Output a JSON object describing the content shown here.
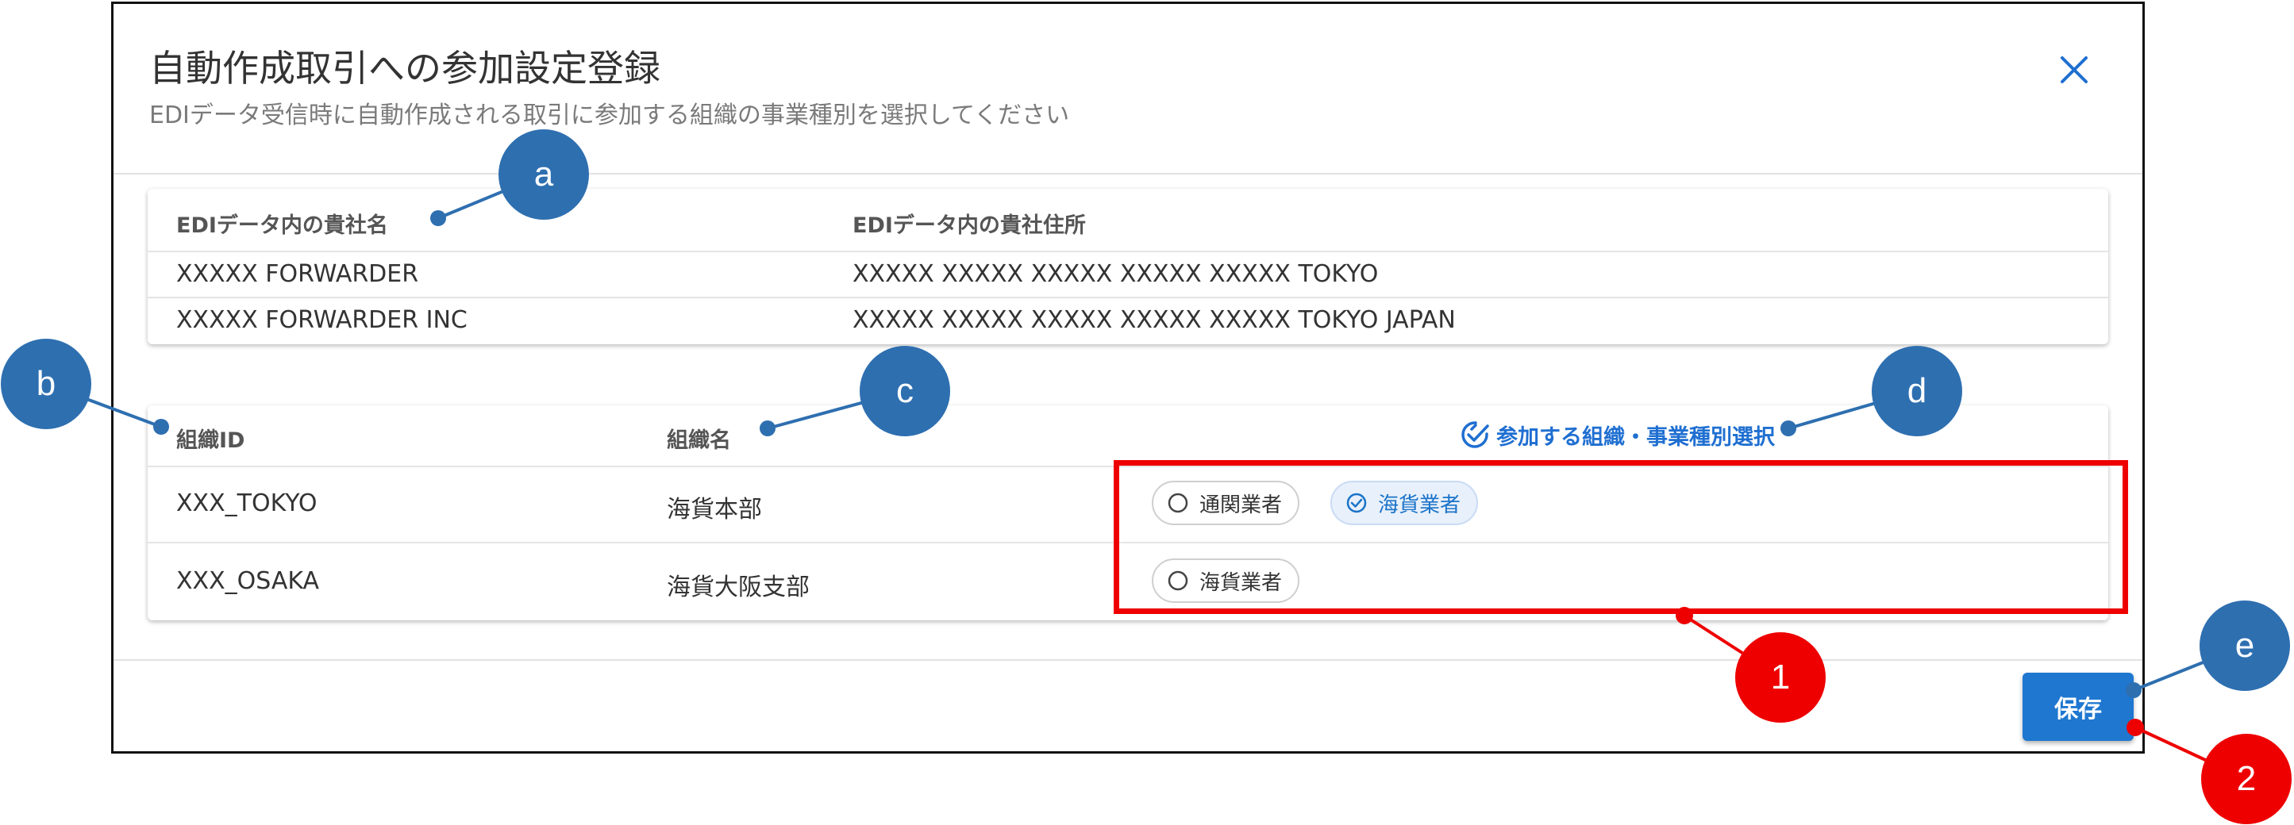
{
  "dialog": {
    "title": "自動作成取引への参加設定登録",
    "subtitle": "EDIデータ受信時に自動作成される取引に参加する組織の事業種別を選択してください",
    "close_glyph": "✕"
  },
  "edi_table": {
    "headers": [
      "EDIデータ内の貴社名",
      "EDIデータ内の貴社住所"
    ],
    "rows": [
      [
        "XXXXX FORWARDER",
        "XXXXX XXXXX XXXXX XXXXX XXXXX TOKYO"
      ],
      [
        "XXXXX FORWARDER INC",
        "XXXXX XXXXX XXXXX XXXXX XXXXX TOKYO JAPAN"
      ]
    ]
  },
  "org_table": {
    "headers": [
      "組織ID",
      "組織名"
    ],
    "select_header": "参加する組織・事業種別選択",
    "rows": [
      {
        "id": "XXX_TOKYO",
        "name": "海貨本部",
        "chips": [
          {
            "label": "通関業者",
            "selected": false
          },
          {
            "label": "海貨業者",
            "selected": true
          }
        ]
      },
      {
        "id": "XXX_OSAKA",
        "name": "海貨大阪支部",
        "chips": [
          {
            "label": "海貨業者",
            "selected": false
          }
        ]
      }
    ]
  },
  "footer": {
    "save_label": "保存"
  },
  "callouts": {
    "a": "a",
    "b": "b",
    "c": "c",
    "d": "d",
    "e": "e",
    "one": "1",
    "two": "2"
  },
  "colors": {
    "callout_blue": "#2e6fb0",
    "callout_red": "#ee0000",
    "accent": "#1f77d0",
    "chip_selected_bg": "#e8f0fb"
  },
  "icons": {
    "close": "close-icon",
    "select_all": "check-circle-double-icon",
    "chip_unselected": "radio-circle-icon",
    "chip_selected": "check-circle-icon"
  }
}
